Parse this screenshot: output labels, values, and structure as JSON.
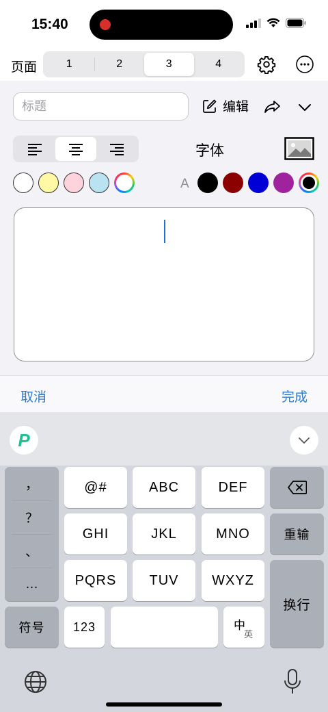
{
  "status": {
    "time": "15:40"
  },
  "header": {
    "page_label": "页面",
    "pages": [
      "1",
      "2",
      "3",
      "4"
    ],
    "active_page": "3"
  },
  "editor": {
    "title_placeholder": "标题",
    "edit_label": "编辑",
    "font_label": "字体",
    "font_color_letter": "A",
    "background_colors": [
      "#ffffff",
      "#fff9a6",
      "#ffd3dc",
      "#b9e3f0"
    ],
    "text_colors": [
      "#000000",
      "#8b0000",
      "#0000d6",
      "#a0239e"
    ],
    "text_value": ""
  },
  "actions": {
    "cancel": "取消",
    "done": "完成"
  },
  "keyboard": {
    "punctuation": [
      "，",
      "？",
      "、",
      "…"
    ],
    "keys": {
      "k1": "@#",
      "k2": "ABC",
      "k3": "DEF",
      "k4": "GHI",
      "k5": "JKL",
      "k6": "MNO",
      "k7": "PQRS",
      "k8": "TUV",
      "k9": "WXYZ",
      "retype": "重输",
      "enter": "换行",
      "symbols": "符号",
      "numbers": "123",
      "zh": "中",
      "en": "英",
      "logo": "P"
    }
  },
  "colors": {
    "accent": "#2f7bd0",
    "caret": "#1e6fd9"
  }
}
